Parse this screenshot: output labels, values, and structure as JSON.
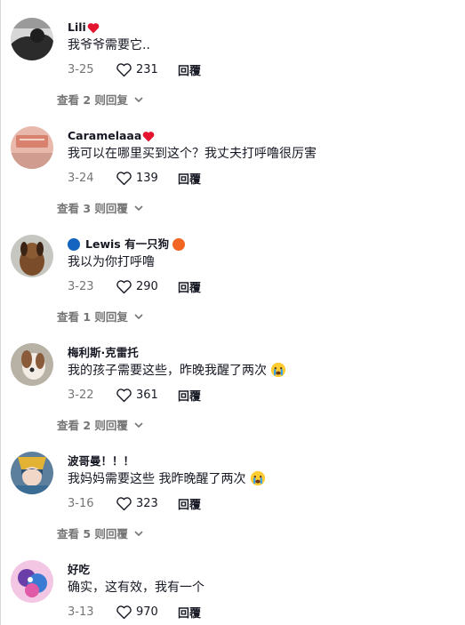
{
  "comments": [
    {
      "username": "Lili",
      "text": "我爷爷需要它..",
      "date": "3-25",
      "likes": "231",
      "reply": "回覆",
      "more": "查看 2 则回复"
    },
    {
      "username": "Caramelaaa",
      "text": "我可以在哪里买到这个？我丈夫打呼噜很厉害",
      "date": "3-24",
      "likes": "139",
      "reply": "回覆",
      "more": "查看 3 则回覆"
    },
    {
      "username": "Lewis 有一只狗",
      "text": "我以为你打呼噜",
      "date": "3-23",
      "likes": "290",
      "reply": "回覆",
      "more": "查看 1 则回复"
    },
    {
      "username": "梅利斯·克雷托",
      "text": "我的孩子需要这些，昨晚我醒了两次",
      "date": "3-22",
      "likes": "361",
      "reply": "回覆",
      "more": "查看 2 则回覆"
    },
    {
      "username": "波哥曼！！！",
      "text": "我妈妈需要这些 我昨晚醒了两次",
      "date": "3-16",
      "likes": "323",
      "reply": "回覆",
      "more": "查看 5 则回覆"
    },
    {
      "username": "好吃",
      "text": "确实，这有效，我有一个",
      "date": "3-13",
      "likes": "970",
      "reply": "回覆"
    }
  ],
  "icons": {
    "like": "heart-outline-icon",
    "expand": "chevron-down-icon",
    "emoji_heart": "red-heart-emoji",
    "emoji_cry": "crying-face-emoji"
  },
  "colors": {
    "heart_red": "#e6152f",
    "blue_circle": "#1565c0",
    "orange_circle": "#f26522",
    "muted": "#757575"
  }
}
